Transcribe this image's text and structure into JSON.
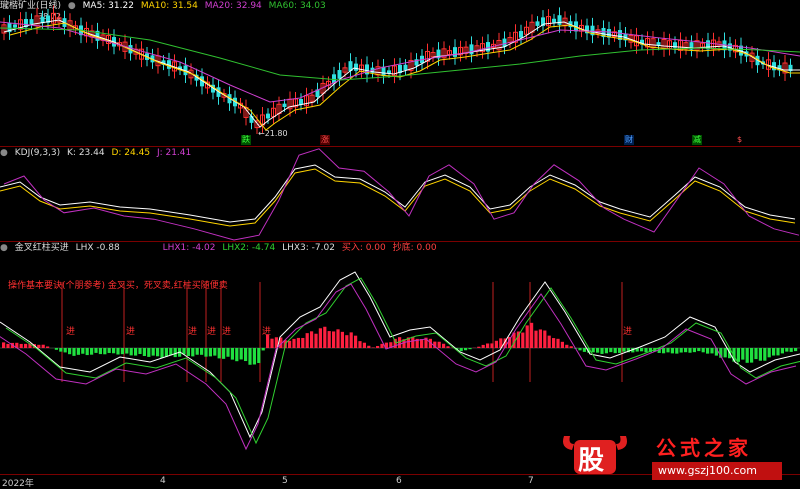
{
  "main": {
    "title": "瓏楷矿业(日线)",
    "ma": [
      {
        "label": "MA5: 31.22",
        "color": "#ffffff"
      },
      {
        "label": "MA10: 31.54",
        "color": "#ffd400"
      },
      {
        "label": "MA20: 32.94",
        "color": "#d040d0"
      },
      {
        "label": "MA60: 34.03",
        "color": "#30c030"
      }
    ],
    "high_label": "38.72",
    "low_label": "←21.80",
    "tags": [
      {
        "text": "跌",
        "color": "#3cff3c",
        "bg": "#005000"
      },
      {
        "text": "涨",
        "color": "#ff5050",
        "bg": "#500000"
      },
      {
        "text": "财",
        "color": "#50a0ff",
        "bg": "#002050"
      },
      {
        "text": "减",
        "color": "#3cff3c",
        "bg": "#005000"
      },
      {
        "text": "$",
        "color": "#ff5050",
        "bg": "#000000"
      }
    ]
  },
  "kdj": {
    "name": "KDJ(9,3,3)",
    "k": "K: 23.44",
    "d": "D: 24.45",
    "j": "J: 21.41"
  },
  "lhx": {
    "name": "金叉红柱买进",
    "lhx": "LHX -0.88",
    "lhx1": "LHX1: -4.02",
    "lhx2": "LHX2: -4.74",
    "lhx3": "LHX3: -7.02",
    "buy": "买入: 0.00",
    "sell": "抄底: 0.00",
    "note": "操作基本要诀(个朋参考) 金叉买，死叉卖,红柱买随便卖",
    "signal_label": "进"
  },
  "xaxis": {
    "labels": [
      "2022年",
      "4",
      "5",
      "6",
      "7"
    ]
  },
  "watermark": {
    "big": "股",
    "site": "公式之家",
    "url": "www.gszj100.com"
  }
}
